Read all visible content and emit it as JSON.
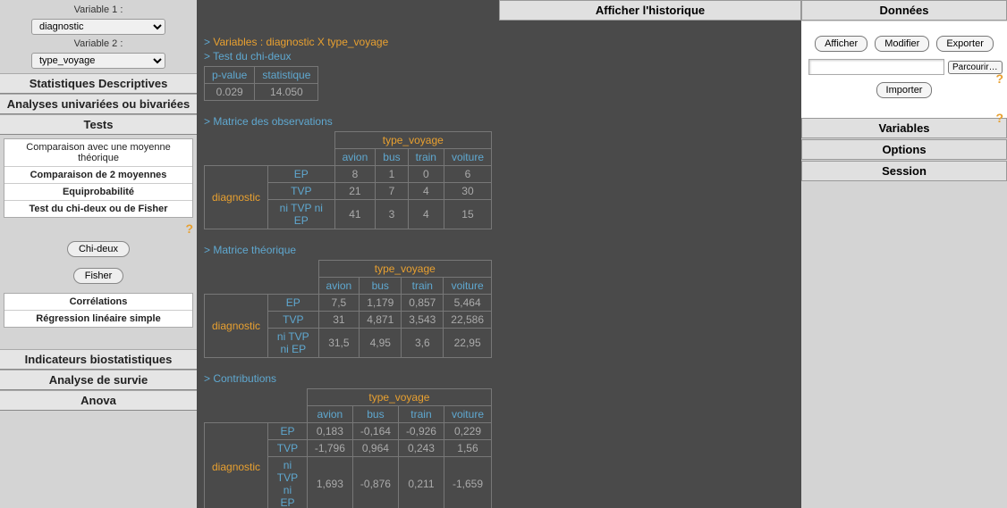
{
  "sidebar": {
    "var1_label": "Variable 1 :",
    "var1_value": "diagnostic",
    "var2_label": "Variable 2 :",
    "var2_value": "type_voyage",
    "nav": {
      "stats_desc": "Statistiques Descriptives",
      "analyses": "Analyses univariées ou bivariées",
      "tests": "Tests",
      "indicateurs": "Indicateurs biostatistiques",
      "survie": "Analyse de survie",
      "anova": "Anova"
    },
    "tests_sub": {
      "comp_moy_theo": "Comparaison avec une moyenne théorique",
      "comp_2moy": "Comparaison de 2 moyennes",
      "equiprob": "Equiprobabilité",
      "chi2_fisher": "Test du chi-deux ou de Fisher"
    },
    "btn_chi2": "Chi-deux",
    "btn_fisher": "Fisher",
    "corr_sub": {
      "correlations": "Corrélations",
      "regression": "Régression linéaire simple"
    }
  },
  "main": {
    "title_vars": "Variables : diagnostic X type_voyage",
    "title_test": "Test du chi-deux",
    "pvalue_h": "p-value",
    "stat_h": "statistique",
    "pvalue_v": "0.029",
    "stat_v": "14.050",
    "title_obs": "Matrice des observations",
    "col_var": "type_voyage",
    "row_var": "diagnostic",
    "cols": [
      "avion",
      "bus",
      "train",
      "voiture"
    ],
    "rows": [
      "EP",
      "TVP",
      "ni TVP ni EP"
    ],
    "obs": [
      [
        "8",
        "1",
        "0",
        "6"
      ],
      [
        "21",
        "7",
        "4",
        "30"
      ],
      [
        "41",
        "3",
        "4",
        "15"
      ]
    ],
    "title_theo": "Matrice théorique",
    "theo": [
      [
        "7,5",
        "1,179",
        "0,857",
        "5,464"
      ],
      [
        "31",
        "4,871",
        "3,543",
        "22,586"
      ],
      [
        "31,5",
        "4,95",
        "3,6",
        "22,95"
      ]
    ],
    "title_contrib": "Contributions",
    "contrib": [
      [
        "0,183",
        "-0,164",
        "-0,926",
        "0,229"
      ],
      [
        "-1,796",
        "0,964",
        "0,243",
        "1,56"
      ],
      [
        "1,693",
        "-0,876",
        "0,211",
        "-1,659"
      ]
    ]
  },
  "right": {
    "historique": "Afficher l'historique",
    "donnees": "Données",
    "afficher": "Afficher",
    "modifier": "Modifier",
    "exporter": "Exporter",
    "parcourir": "Parcourir…",
    "importer": "Importer",
    "variables": "Variables",
    "options": "Options",
    "session": "Session"
  }
}
